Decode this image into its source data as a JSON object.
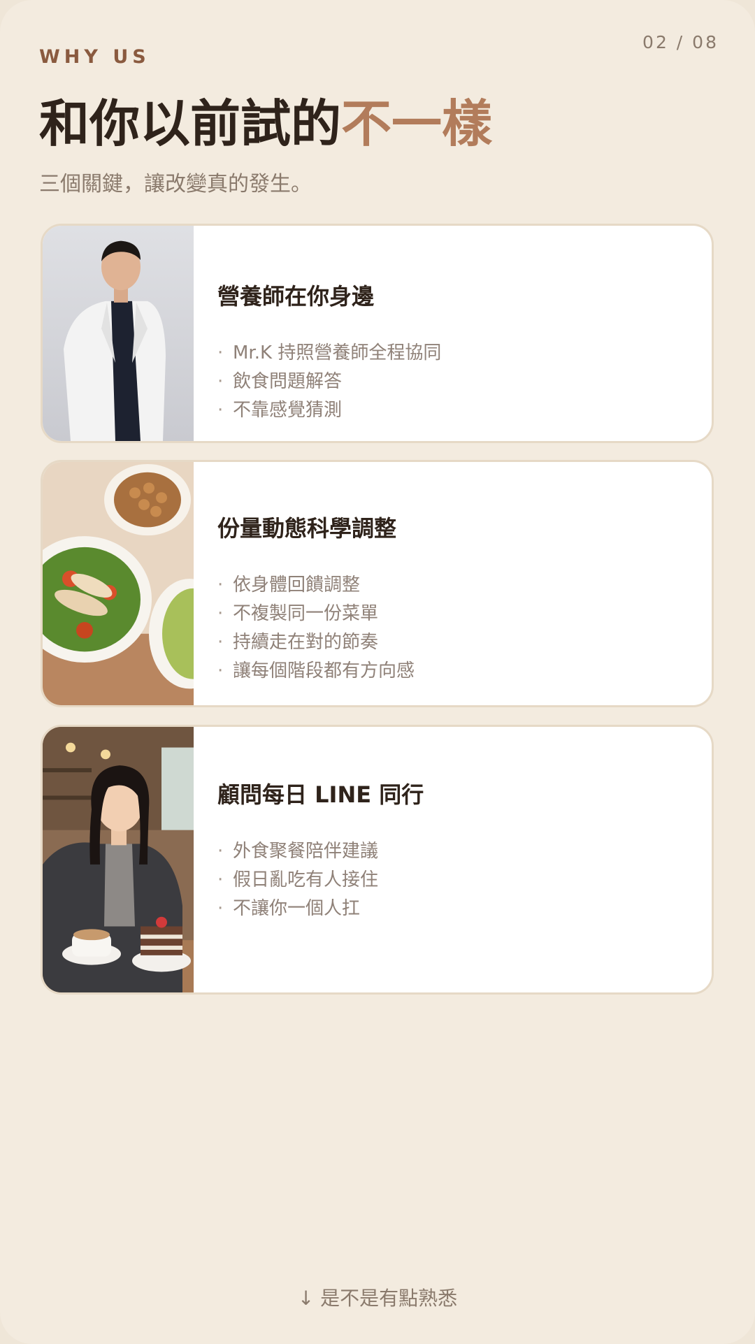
{
  "header": {
    "eyebrow": "WHY US",
    "page_indicator": "02 / 08",
    "title_main": "和你以前試的",
    "title_accent": "不一樣",
    "subtitle": "三個關鍵，讓改變真的發生。"
  },
  "cards": [
    {
      "title": "營養師在你身邊",
      "image": "nutritionist-portrait",
      "bullets": [
        "Mr.K 持照營養師全程協同",
        "飲食問題解答",
        "不靠感覺猜測"
      ]
    },
    {
      "title": "份量動態科學調整",
      "image": "healthy-food-bowls",
      "bullets": [
        "依身體回饋調整",
        "不複製同一份菜單",
        "持續走在對的節奏",
        "讓每個階段都有方向感"
      ]
    },
    {
      "title": "顧問每日 LINE 同行",
      "image": "advisor-cafe-selfie",
      "bullets": [
        "外食聚餐陪伴建議",
        "假日亂吃有人接住",
        "不讓你一個人扛"
      ]
    }
  ],
  "bullet_marker": "·",
  "footer": {
    "hint": "↓ 是不是有點熟悉"
  },
  "colors": {
    "background": "#f3ebdf",
    "accent": "#b27c5b",
    "eyebrow": "#8a5a3f",
    "heading": "#2f231b",
    "muted": "#8a7a6c"
  }
}
